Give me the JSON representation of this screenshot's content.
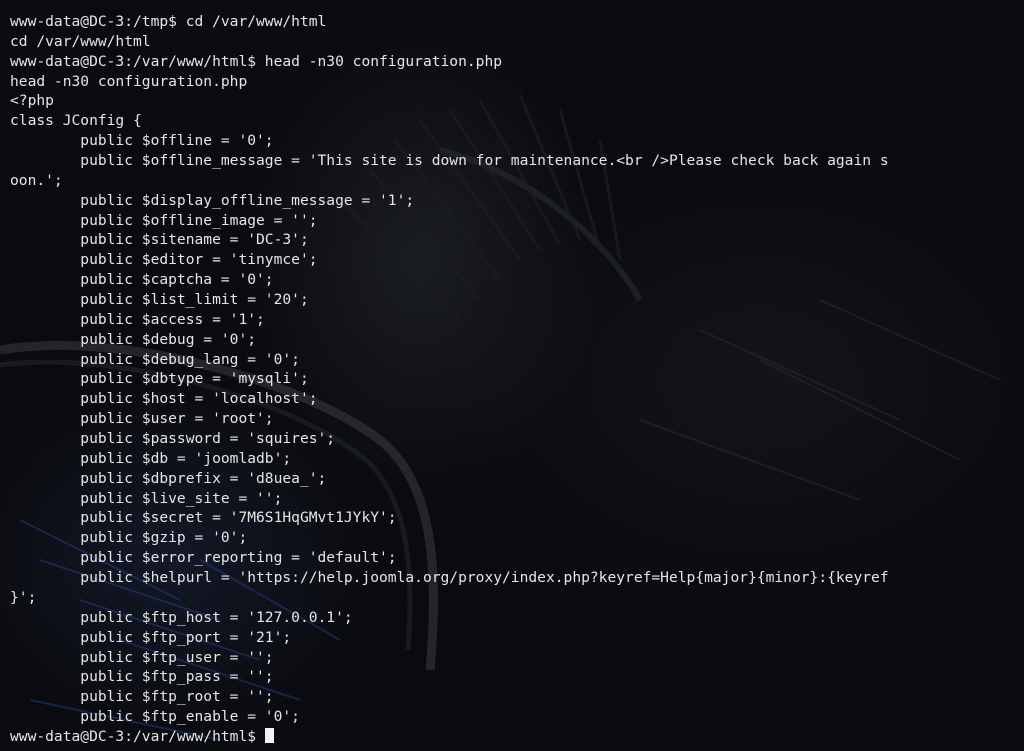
{
  "terminal": {
    "lines": [
      "www-data@DC-3:/tmp$ cd /var/www/html",
      "cd /var/www/html",
      "www-data@DC-3:/var/www/html$ head -n30 configuration.php",
      "head -n30 configuration.php",
      "<?php",
      "class JConfig {",
      "        public $offline = '0';",
      "        public $offline_message = 'This site is down for maintenance.<br />Please check back again s",
      "oon.';",
      "        public $display_offline_message = '1';",
      "        public $offline_image = '';",
      "        public $sitename = 'DC-3';",
      "        public $editor = 'tinymce';",
      "        public $captcha = '0';",
      "        public $list_limit = '20';",
      "        public $access = '1';",
      "        public $debug = '0';",
      "        public $debug_lang = '0';",
      "        public $dbtype = 'mysqli';",
      "        public $host = 'localhost';",
      "        public $user = 'root';",
      "        public $password = 'squires';",
      "        public $db = 'joomladb';",
      "        public $dbprefix = 'd8uea_';",
      "        public $live_site = '';",
      "        public $secret = '7M6S1HqGMvt1JYkY';",
      "        public $gzip = '0';",
      "        public $error_reporting = 'default';",
      "        public $helpurl = 'https://help.joomla.org/proxy/index.php?keyref=Help{major}{minor}:{keyref",
      "}';",
      "        public $ftp_host = '127.0.0.1';",
      "        public $ftp_port = '21';",
      "        public $ftp_user = '';",
      "        public $ftp_pass = '';",
      "        public $ftp_root = '';",
      "        public $ftp_enable = '0';"
    ],
    "prompt": "www-data@DC-3:/var/www/html$ "
  }
}
